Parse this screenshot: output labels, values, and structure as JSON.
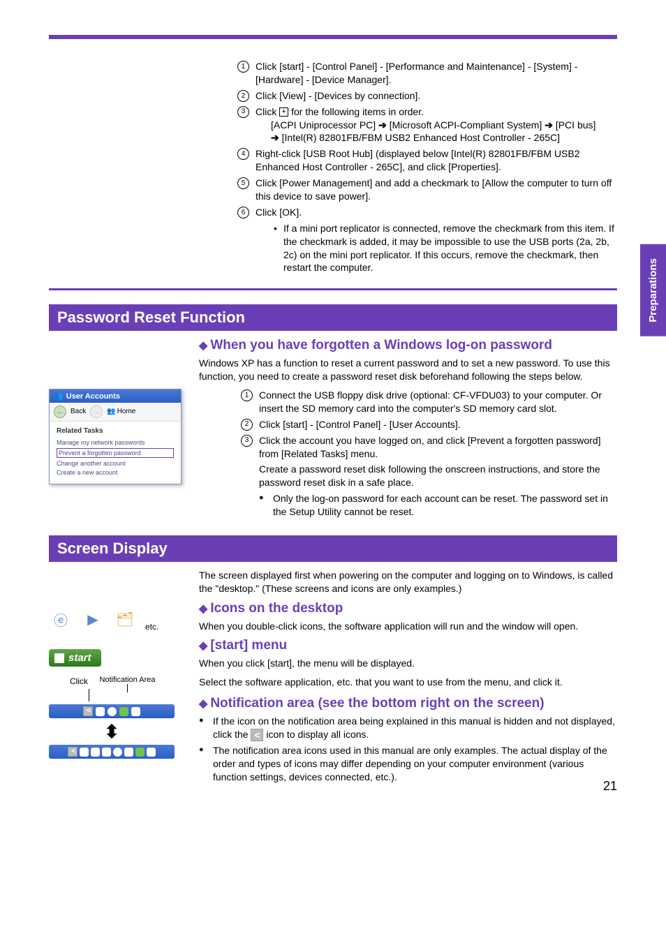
{
  "sideTab": "Preparations",
  "top": {
    "steps": [
      "Click [start] - [Control Panel] - [Performance and Maintenance] - [System] - [Hardware] - [Device Manager].",
      "Click [View] - [Devices by connection].",
      "Click  for the following items in order.",
      "Right-click [USB Root Hub] (displayed below [Intel(R) 82801FB/FBM USB2 Enhanced Host Controller - 265C], and click [Properties].",
      "Click [Power Management] and add a checkmark to [Allow the computer to turn off this device to save power].",
      "Click [OK]."
    ],
    "step3_detail_a": "[ACPI Uniprocessor PC]",
    "step3_detail_b": "[Microsoft ACPI-Compliant System]",
    "step3_detail_c": "[PCI bus]",
    "step3_detail_d": "[Intel(R) 82801FB/FBM USB2 Enhanced Host Controller - 265C]",
    "note": "If a mini port replicator is connected, remove the checkmark from this item. If the checkmark is added, it may be impossible to use the USB ports (2a, 2b, 2c) on the mini port replicator. If this occurs, remove the checkmark, then restart the computer."
  },
  "pwReset": {
    "title": "Password Reset Function",
    "heading": "When you have forgotten a Windows log-on password",
    "intro": "Windows XP has a function to reset a current password and to set a new password. To use this function, you need to create a password reset disk beforehand following the steps below.",
    "steps": [
      "Connect the USB floppy disk drive (optional: CF-VFDU03) to your computer.  Or insert the SD memory card into the computer's SD memory card slot.",
      "Click [start] - [Control Panel] - [User Accounts].",
      "Click the account you have logged on, and click [Prevent a forgotten password] from [Related Tasks] menu."
    ],
    "after3a": "Create a password reset disk following the onscreen instructions, and store the password reset disk in a safe place.",
    "after3b": "Only the log-on password for each account can be reset. The password set in the Setup Utility cannot be reset.",
    "ua": {
      "title": "User Accounts",
      "back": "Back",
      "home": "Home",
      "related": "Related Tasks",
      "links": [
        "Manage my network passwords",
        "Prevent a forgotten password",
        "Change another account",
        "Create a new account"
      ]
    }
  },
  "screen": {
    "title": "Screen Display",
    "intro": "The screen displayed first when powering on the computer and logging on to Windows, is called the \"desktop.\" (These screens and icons are only examples.)",
    "iconsHeading": "Icons on the desktop",
    "iconsBody": "When you double-click icons, the software application will run and the window will open.",
    "etc": "etc.",
    "startHeading": "[start] menu",
    "startBody1": "When you click [start], the menu will be displayed.",
    "startBody2": "Select the software application, etc. that you want to use from the menu, and click it.",
    "startLabel": "start",
    "notifHeading": "Notification area (see the bottom right on the screen)",
    "notifBullets": [
      "If the icon on the notification area being explained in this manual is hidden and not displayed, click the ",
      " icon to display all icons.",
      "The notification area icons used in this manual are only examples.  The actual display of the order and types of icons may differ depending on your computer environment (various function settings, devices connected, etc.)."
    ],
    "click": "Click",
    "notifArea": "Notification Area"
  },
  "pageNum": "21"
}
